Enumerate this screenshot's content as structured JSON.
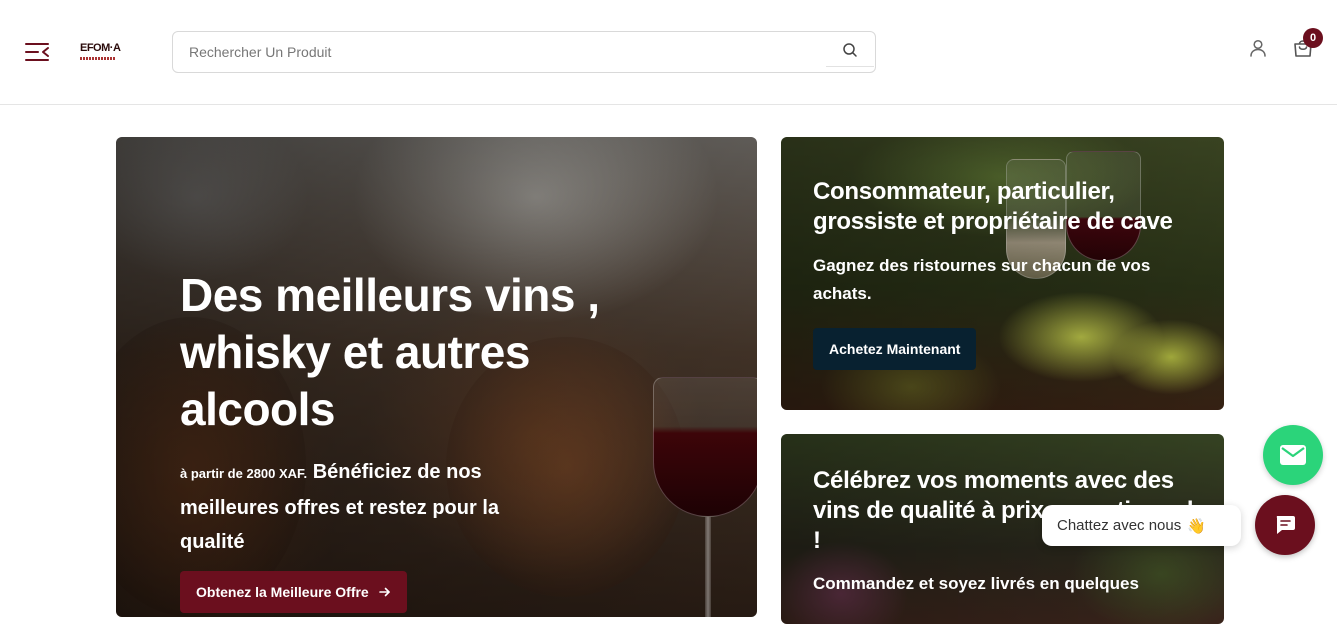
{
  "header": {
    "logo_text": "EFOM·A",
    "search": {
      "placeholder": "Rechercher Un Produit",
      "value": ""
    },
    "cart_count": "0"
  },
  "hero": {
    "title": "Des meilleurs vins , whisky et autres alcools",
    "price_note": "à partir de 2800 XAF.",
    "subtitle": "Bénéficiez de nos meilleures offres et restez pour la qualité",
    "button_label": "Obtenez la Meilleure Offre"
  },
  "promo_cards": [
    {
      "title": "Consommateur, particulier, grossiste et propriétaire de cave",
      "text": "Gagnez des ristournes sur chacun de vos achats.",
      "button_label": "Achetez Maintenant"
    },
    {
      "title": "Célébrez vos moments avec des vins de qualité à prix exceptionnels !",
      "text": "Commandez et soyez livrés en quelques"
    }
  ],
  "chat": {
    "bubble_text": "Chattez avec nous",
    "bubble_emoji": "👋"
  },
  "colors": {
    "brand": "#6b0f1e",
    "dark_button": "#082130",
    "mail_fab": "#2bd47a"
  },
  "icons": [
    "menu-icon",
    "search-icon",
    "user-icon",
    "shopping-bag-icon",
    "arrow-right-icon",
    "mail-icon",
    "chat-icon"
  ]
}
